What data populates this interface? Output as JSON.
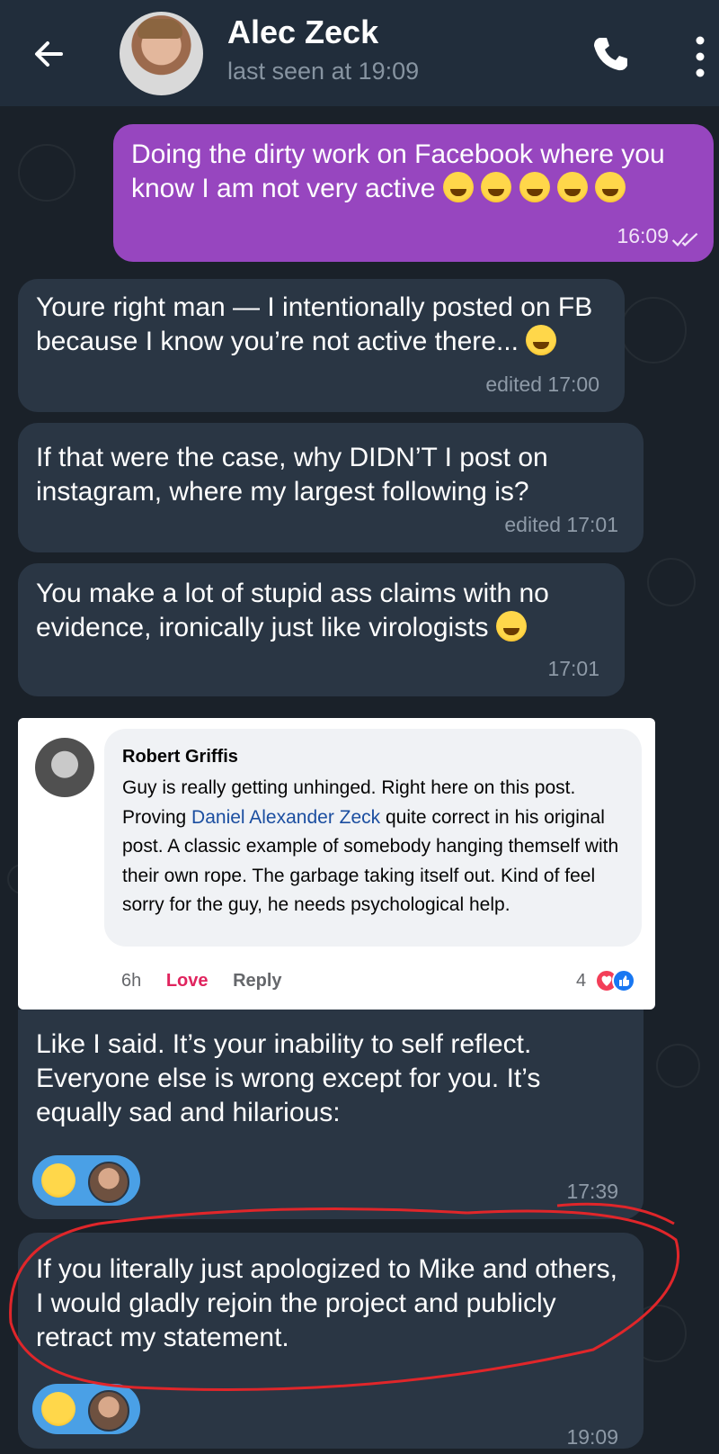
{
  "header": {
    "contact_name": "Alec Zeck",
    "status": "last seen at 19:09",
    "icons": [
      "back-arrow-icon",
      "avatar",
      "phone-icon",
      "more-vertical-icon"
    ]
  },
  "messages": [
    {
      "direction": "out",
      "text": "Doing the dirty work on Facebook where you know I am not very active",
      "emoji": "joy x5",
      "time": "16:09",
      "status": "read"
    },
    {
      "direction": "in",
      "text": "Youre right man — I intentionally posted on FB because I know you’re not active there...",
      "meta": "edited 17:00"
    },
    {
      "direction": "in",
      "text": "If that were the case, why DIDN’T I post on instagram, where my largest following is?",
      "meta": "edited 17:01"
    },
    {
      "direction": "in",
      "text": "You make a lot of stupid ass claims with no evidence, ironically just like virologists",
      "meta": "17:01"
    },
    {
      "direction": "in",
      "text": "Like I said. It’s your inability to self reflect. Everyone else is wrong except for you. It’s equally sad and hilarious:",
      "meta": "17:39"
    },
    {
      "direction": "in",
      "text": "If you literally just apologized to Mike and others, I would gladly rejoin the project and publicly retract my statement.",
      "meta": "19:09"
    }
  ],
  "fb_comment": {
    "author": "Robert Griffis",
    "text_before": "Guy is really getting unhinged. Right here on this post. Proving ",
    "link": "Daniel Alexander Zeck",
    "text_after": " quite correct in his original post. A classic example of somebody hanging themself with their own rope. The garbage taking itself out. Kind of feel sorry for the guy, he needs psychological help.",
    "age": "6h",
    "love": "Love",
    "reply": "Reply",
    "reaction_count": "4"
  },
  "colors": {
    "background": "#1a2129",
    "header": "#212d3b",
    "outgoing_bubble": "#9746bf",
    "incoming_bubble": "#2a3644",
    "reaction_pill": "#4aa0e6",
    "annotation": "#e0262a"
  }
}
